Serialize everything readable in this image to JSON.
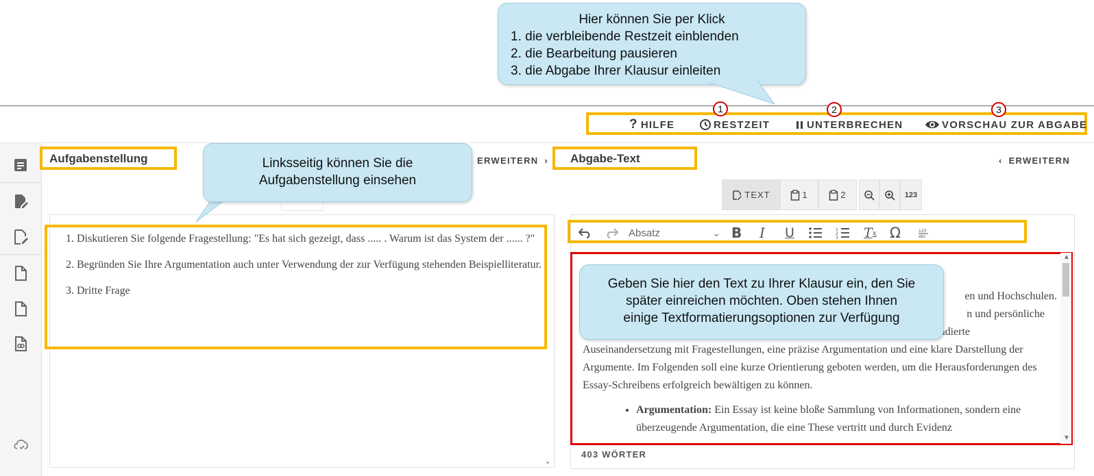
{
  "callouts": {
    "top": {
      "heading": "Hier können Sie per Klick",
      "items": [
        "1. die verbleibende Restzeit einblenden",
        "2. die Bearbeitung pausieren",
        "3. die Abgabe Ihrer Klausur einleiten"
      ]
    },
    "left": {
      "line1": "Linksseitig können Sie die",
      "line2": "Aufgabenstellung einsehen"
    },
    "right": {
      "line1": "Geben Sie hier den Text zu Ihrer Klausur ein, den Sie",
      "line2": "später einreichen möchten. Oben stehen Ihnen",
      "line3": "einige Textformatierungsoptionen zur Verfügung"
    }
  },
  "header": {
    "help_label": "HILFE",
    "time_label": "RESTZEIT",
    "pause_label": "UNTERBRECHEN",
    "preview_label": "VORSCHAU ZUR ABGABE",
    "markers": [
      "1",
      "2",
      "3"
    ]
  },
  "sidebar": {
    "icons": [
      "document-list-icon",
      "edit-filled-icon",
      "edit-outline-icon",
      "file-icon",
      "file-icon",
      "file-link-icon",
      "cloud-check-icon"
    ]
  },
  "left_panel": {
    "title": "Aufgabenstellung",
    "expand_label": "ERWEITERN",
    "tasks": [
      "1. Diskutieren Sie folgende Fragestellung: \"Es hat sich gezeigt, dass ..... . Warum ist das System der ......   ?\"",
      "2. Begründen Sie Ihre Argumentation auch unter Verwendung der zur Verfügung stehenden Beispielliteratur.",
      "3. Dritte Frage"
    ]
  },
  "right_panel": {
    "title": "Abgabe-Text",
    "expand_label": "ERWEITERN",
    "view_tabs": {
      "text": "TEXT",
      "clip1": "1",
      "clip2": "2",
      "counter": "123"
    },
    "format_select": "Absatz",
    "editor": {
      "line_a": "en und Hochschulen.",
      "line_b": "n und persönliche",
      "line_c": "ie fundierte",
      "para": "Auseinandersetzung mit Fragestellungen, eine präzise Argumentation und eine klare Darstellung der Argumente. Im Folgenden soll eine kurze Orientierung geboten werden, um die Herausforderungen des Essay-Schreibens erfolgreich bewältigen zu können.",
      "bullet_bold": "Argumentation:",
      "bullet_text": " Ein Essay ist keine bloße Sammlung von Informationen, sondern eine überzeugende Argumentation, die eine These vertritt und durch Evidenz"
    },
    "word_count": "403 WÖRTER"
  },
  "colors": {
    "highlight_yellow": "#f5b800",
    "highlight_red": "#e00000",
    "bubble_blue": "#c9e8f4"
  }
}
